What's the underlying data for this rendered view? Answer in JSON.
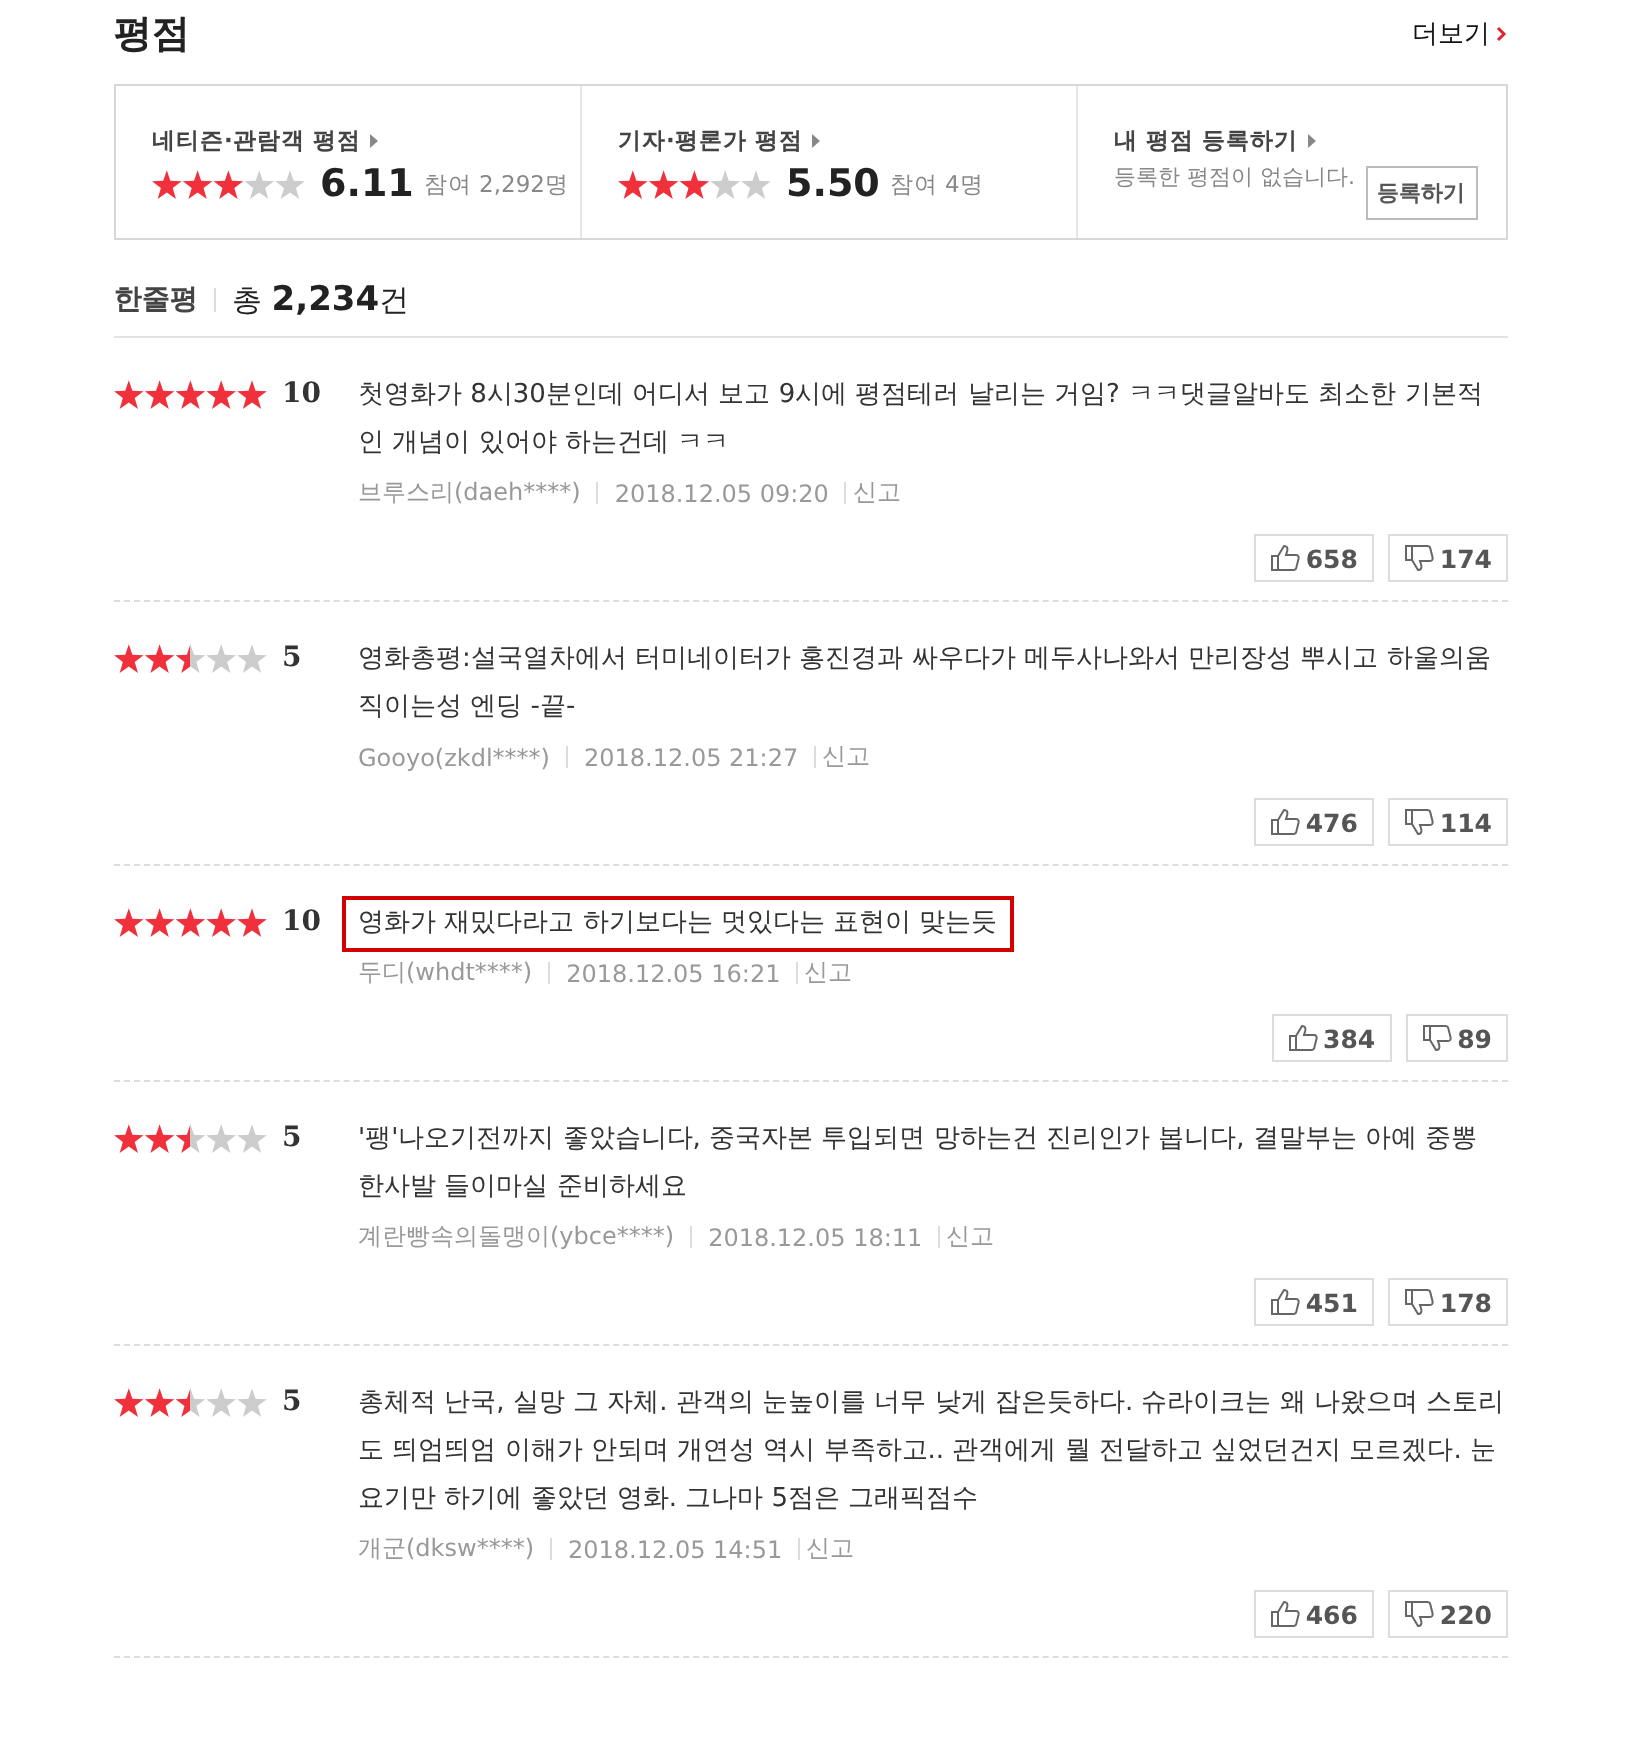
{
  "header": {
    "title": "평점",
    "more_link": "더보기"
  },
  "summary": [
    {
      "kind": "score",
      "label": "네티즌·관람객 평점",
      "stars": 3,
      "score": "6.11",
      "participants": "참여 2,292명"
    },
    {
      "kind": "score",
      "label": "기자·평론가 평점",
      "stars": 3,
      "score": "5.50",
      "participants": "참여 4명"
    },
    {
      "kind": "register",
      "label": "내 평점 등록하기",
      "message": "등록한 평점이 없습니다.",
      "button": "등록하기"
    }
  ],
  "comments_header": {
    "title": "한줄평",
    "total_label": "총",
    "total": "2,234",
    "unit": "건"
  },
  "reviews": [
    {
      "stars": 5,
      "score": "10",
      "text": "첫영화가 8시30분인데 어디서 보고 9시에 평점테러 날리는 거임? ㅋㅋ댓글알바도 최소한 기본적인 개념이 있어야 하는건데 ㅋㅋ",
      "author": "브루스리(daeh****)",
      "date": "2018.12.05 09:20",
      "report": "신고",
      "likes": "658",
      "dislikes": "174",
      "highlighted": false
    },
    {
      "stars": 2.5,
      "score": "5",
      "text": "영화총평:설국열차에서 터미네이터가 홍진경과 싸우다가 메두사나와서 만리장성 뿌시고 하울의움직이는성 엔딩 -끝-",
      "author": "Gooyo(zkdl****)",
      "date": "2018.12.05 21:27",
      "report": "신고",
      "likes": "476",
      "dislikes": "114",
      "highlighted": false
    },
    {
      "stars": 5,
      "score": "10",
      "text": "영화가 재밌다라고 하기보다는 멋있다는 표현이 맞는듯",
      "author": "두디(whdt****)",
      "date": "2018.12.05 16:21",
      "report": "신고",
      "likes": "384",
      "dislikes": "89",
      "highlighted": true
    },
    {
      "stars": 2.5,
      "score": "5",
      "text": "'팽'나오기전까지 좋았습니다, 중국자본 투입되면 망하는건 진리인가 봅니다, 결말부는 아예 중뽕 한사발 들이마실 준비하세요",
      "author": "계란빵속의돌맹이(ybce****)",
      "date": "2018.12.05 18:11",
      "report": "신고",
      "likes": "451",
      "dislikes": "178",
      "highlighted": false
    },
    {
      "stars": 2.5,
      "score": "5",
      "text": "총체적 난국, 실망 그 자체. 관객의 눈높이를 너무 낮게 잡은듯하다. 슈라이크는 왜 나왔으며 스토리도 띄엄띄엄 이해가 안되며 개연성 역시 부족하고.. 관객에게 뭘 전달하고 싶었던건지 모르겠다. 눈요기만 하기에 좋았던 영화. 그나마 5점은 그래픽점수",
      "author": "개군(dksw****)",
      "date": "2018.12.05 14:51",
      "report": "신고",
      "likes": "466",
      "dislikes": "220",
      "highlighted": false
    }
  ]
}
